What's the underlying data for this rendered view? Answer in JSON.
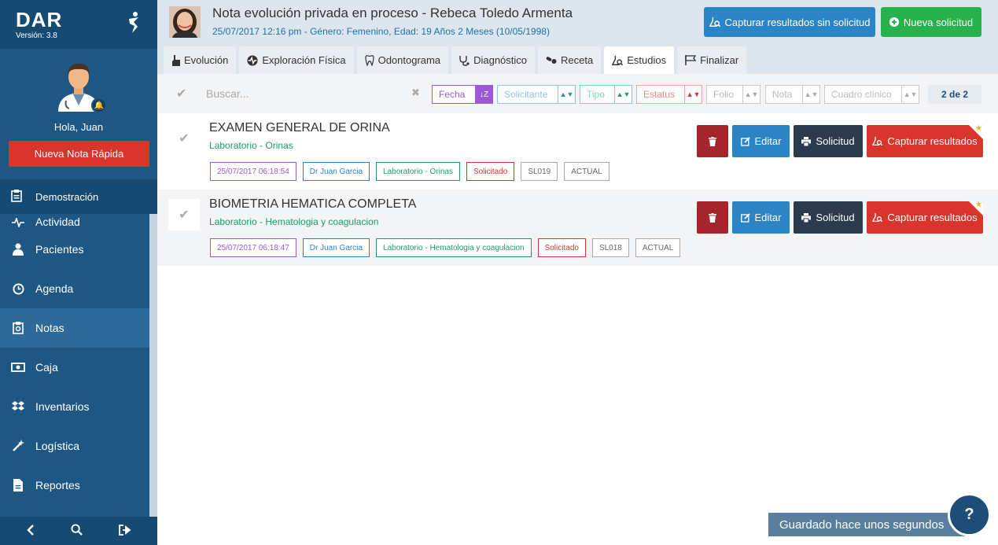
{
  "app": {
    "name": "DAR",
    "version": "Versión: 3.8"
  },
  "user": {
    "greeting": "Hola, Juan",
    "quick_note": "Nueva Nota Rápida"
  },
  "sidebar": {
    "demo": "Demostración",
    "items": [
      {
        "label": "Actividad",
        "icon": "pulse-icon"
      },
      {
        "label": "Pacientes",
        "icon": "person-icon"
      },
      {
        "label": "Agenda",
        "icon": "clock-icon"
      },
      {
        "label": "Notas",
        "icon": "clipboard-icon"
      },
      {
        "label": "Caja",
        "icon": "money-icon"
      },
      {
        "label": "Inventarios",
        "icon": "dropbox-icon"
      },
      {
        "label": "Logística",
        "icon": "wand-icon"
      },
      {
        "label": "Reportes",
        "icon": "file-icon"
      }
    ]
  },
  "header": {
    "title": "Nota evolución privada en proceso - Rebeca Toledo Armenta",
    "subtitle": "25/07/2017 12:16 pm - Género: Femenino, Edad: 19 Años 2 Meses (10/05/1998)",
    "capture_btn": "Capturar resultados sin solicitud",
    "new_btn": "Nueva solicitud"
  },
  "tabs": [
    {
      "label": "Evolución"
    },
    {
      "label": "Exploración Física"
    },
    {
      "label": "Odontograma"
    },
    {
      "label": "Diagnóstico"
    },
    {
      "label": "Receta"
    },
    {
      "label": "Estudios"
    },
    {
      "label": "Finalizar"
    }
  ],
  "filters": {
    "search_placeholder": "Buscar...",
    "fecha": "Fecha",
    "solicitante": "Solicitante",
    "tipo": "Tipo",
    "estatus": "Estatus",
    "folio": "Folio",
    "nota": "Nota",
    "cuadro": "Cuadro clínico",
    "count": "2 de 2"
  },
  "studies": [
    {
      "title": "EXAMEN GENERAL DE ORINA",
      "sub": "Laboratorio - Orinas",
      "tags": [
        "25/07/2017 06:18:54",
        "Dr Juan Garcia",
        "Laboratorio - Orinas",
        "Solicitado",
        "SL019",
        "ACTUAL"
      ]
    },
    {
      "title": "BIOMETRIA HEMATICA COMPLETA",
      "sub": "Laboratorio - Hematologia y coagulacion",
      "tags": [
        "25/07/2017 06:18:47",
        "Dr Juan Garcia",
        "Laboratorio - Hematologia y coagulacion",
        "Solicitado",
        "SL018",
        "ACTUAL"
      ]
    }
  ],
  "row_actions": {
    "edit": "Editar",
    "request": "Solicitud",
    "capture": "Capturar resultados"
  },
  "footer": {
    "saved": "Guardado hace unos segundos",
    "help": "?"
  },
  "colors": {
    "sidebar": "#1f5784",
    "accent_blue": "#2b84c6",
    "green": "#28b24b",
    "red": "#d9352c"
  }
}
